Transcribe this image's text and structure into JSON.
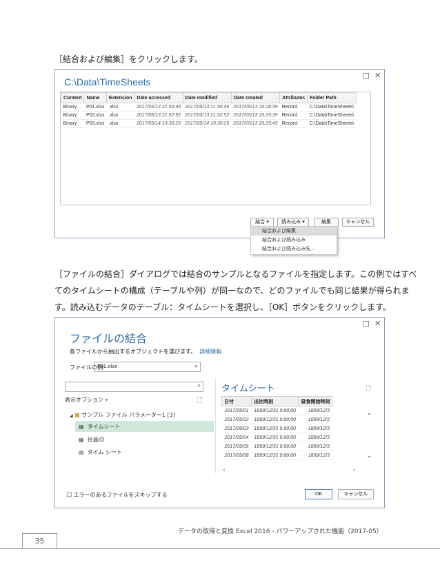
{
  "instruction1": "［結合および編集］をクリックします。",
  "paragraph2": [
    "［ファイルの結合］ダイアログでは結合のサンプルとなるファイルを指定します。この例ではすべ",
    "てのタイムシートの構成（テーブルや列）が同一なので、どのファイルでも同じ結果が得られま",
    "す。読み込むデータのテーブル：タイムシートを選択し、［OK］ボタンをクリックします。"
  ],
  "window1": {
    "title": "C:\\Data\\TimeSheets",
    "columns": [
      "Content",
      "Name",
      "Extension",
      "Date accessed",
      "Date modified",
      "Date created",
      "Attributes",
      "Folder Path"
    ],
    "rows": [
      [
        "Binary",
        "P01.xlsx",
        ".xlsx",
        "2017/05/13 21:56:46",
        "2017/05/13 21:56:46",
        "2017/05/13 20:28:39",
        "Record",
        "C:\\Data\\TimeSheets\\"
      ],
      [
        "Binary",
        "P02.xlsx",
        ".xlsx",
        "2017/05/13 21:52:52",
        "2017/05/13 21:52:52",
        "2017/05/13 20:29:35",
        "Record",
        "C:\\Data\\TimeSheets\\"
      ],
      [
        "Binary",
        "P03.xlsx",
        ".xlsx",
        "2017/05/14 19:30:25",
        "2017/05/14 19:30:25",
        "2017/05/13 20:29:43",
        "Record",
        "C:\\Data\\TimeSheets\\"
      ]
    ],
    "buttons": {
      "combine": "結合",
      "load": "読み込み",
      "edit": "編集",
      "cancel": "キャンセル"
    },
    "menu": [
      "結合および編集",
      "結合および読み込み",
      "結合および読み込み先..."
    ]
  },
  "window2": {
    "title": "ファイルの結合",
    "subtitle": "各ファイルから抽出するオブジェクトを選びます。",
    "link": "詳細情報",
    "sample_label": "ファイルの例:",
    "sample_value": "P01.xlsx",
    "display_options": "表示オプション",
    "tree": {
      "folder": "サンプル ファイル パラメーター1 [3]",
      "items": [
        "タイムシート",
        "社員ID",
        "タイム シート"
      ]
    },
    "preview_title": "タイムシート",
    "preview_columns": [
      "日付",
      "出社時刻",
      "昼食開始時刻"
    ],
    "preview_rows": [
      [
        "2017/05/01",
        "1899/12/31 9:00:00",
        "1899/12/3"
      ],
      [
        "2017/05/02",
        "1899/12/31 9:00:00",
        "1899/12/3"
      ],
      [
        "2017/05/03",
        "1899/12/31 9:00:00",
        "1899/12/3"
      ],
      [
        "2017/05/04",
        "1899/12/31 9:00:00",
        "1899/12/3"
      ],
      [
        "2017/05/05",
        "1899/12/31 9:00:00",
        "1899/12/3"
      ],
      [
        "2017/05/08",
        "1899/12/31 9:00:00",
        "1899/12/3"
      ]
    ],
    "skip_label": "エラーのあるファイルをスキップする",
    "ok": "OK",
    "cancel": "キャンセル"
  },
  "footer": {
    "text": "データの取得と変換 Excel 2016 - パワーアップされた機能（2017-05）",
    "page": "35"
  }
}
